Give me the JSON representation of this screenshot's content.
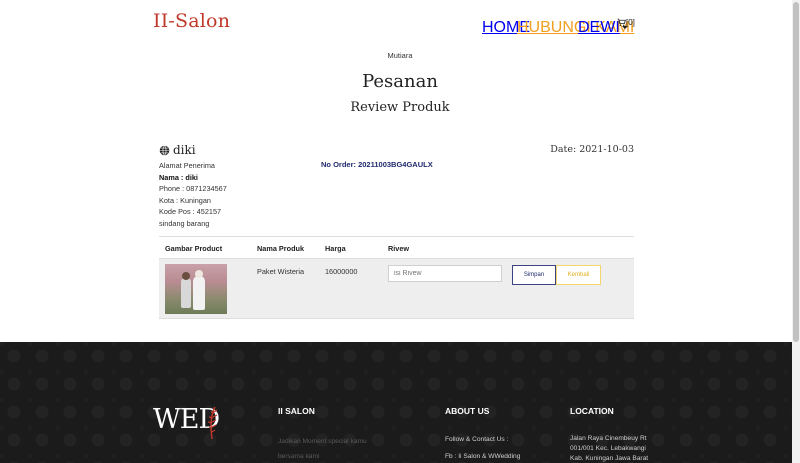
{
  "nav": {
    "brand": "II-Salon",
    "home": "HOME",
    "contact": "HUBUNGI KAMI",
    "user": "DEWI",
    "cart": "[0]"
  },
  "header": {
    "kicker": "Mutiara",
    "title": "Pesanan",
    "subtitle": "Review Produk"
  },
  "recipient": {
    "name": "diki",
    "label": "Alamat Penerima",
    "nama": "Nama : diki",
    "phone": "Phone : 0871234567",
    "kota": "Kota : Kuningan",
    "kodepos": "Kode Pos : 452157",
    "alamat": "sindang barang"
  },
  "order": {
    "number": "No Order: 20211003BG4GAULX",
    "date": "Date: 2021-10-03"
  },
  "table": {
    "headers": [
      "Gambar Product",
      "Nama Produk",
      "Harga",
      "Rivew"
    ],
    "rows": [
      {
        "product": "Paket Wisteria",
        "price": "16000000"
      }
    ],
    "review_placeholder": "isi Rivew",
    "save_label": "Simpan",
    "back_label": "Kembali"
  },
  "footer": {
    "logo_text": "WED",
    "col1_title": "II SALON",
    "col1_text1": "Jadikan Moment special kamu",
    "col1_text2": "bersama kami",
    "col2_title": "ABOUT US",
    "col2_line1": "Follow & Contact Us :",
    "col2_line2": "Fb : Ii Salon & WWedding",
    "col3_title": "LOCATION",
    "col3_line1": "Jalan Raya Cinembeuy Rt",
    "col3_line2": "001/001 Kec. Lebakwangi",
    "col3_line3": "Kab. Kuningan Jawa Barat"
  },
  "colors": {
    "brand": "#c0392b",
    "accent": "#f0a01e",
    "order_no": "#1f2a6e",
    "footer_bg": "#1b1b1b"
  }
}
